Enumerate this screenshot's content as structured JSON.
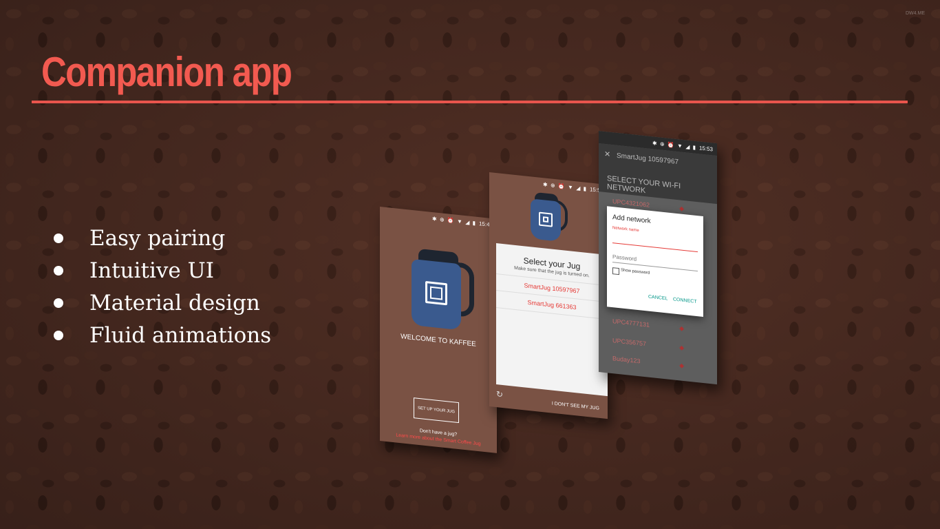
{
  "slide": {
    "watermark": "DW4.ME",
    "title": "Companion app",
    "bullets": [
      "Easy pairing",
      "Intuitive UI",
      "Material design",
      "Fluid animations"
    ]
  },
  "phone_welcome": {
    "time": "15:48",
    "welcome_text": "WELCOME TO KAFFEE",
    "setup_button": "SET UP YOUR JUG",
    "no_jug_text": "Don't have a jug?",
    "learn_more_link": "Learn more about the Smart Coffee Jug"
  },
  "phone_select": {
    "time": "15:51",
    "title": "Select your Jug",
    "subtitle": "Make sure that the jug is turned on.",
    "jugs": [
      "SmartJug 10597967",
      "SmartJug 661363"
    ],
    "not_see_button": "I DON'T SEE MY JUG"
  },
  "phone_wifi": {
    "time": "15:53",
    "jug_name": "SmartJug 10597967",
    "header": "SELECT YOUR WI-FI NETWORK",
    "networks": [
      "UPC4321062",
      "UPC4777131",
      "UPC356757",
      "Buday123"
    ],
    "dialog": {
      "title": "Add network",
      "network_label": "Network name",
      "password_placeholder": "Password",
      "show_password": "Show password",
      "cancel": "CANCEL",
      "connect": "CONNECT"
    }
  },
  "colors": {
    "accent": "#f25a50",
    "phone_bg": "#7a5244",
    "jug_blue": "#3a5a8e",
    "link_red": "#e53935",
    "dialog_teal": "#009688"
  }
}
